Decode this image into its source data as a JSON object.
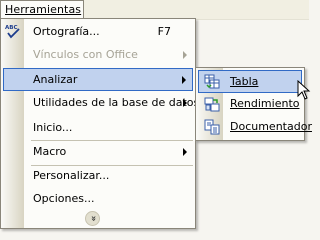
{
  "menubar": {
    "menu_title": "Herramientas"
  },
  "menu": {
    "items": [
      {
        "label": "Ortografía...",
        "shortcut": "F7",
        "icon": "spellcheck-icon",
        "enabled": true
      },
      {
        "label": "Vínculos con Office",
        "enabled": false,
        "submenu": true
      },
      {
        "label": "Analizar",
        "highlighted": true,
        "submenu": true
      },
      {
        "label": "Utilidades de la base de datos",
        "submenu": true
      },
      {
        "label": "Inicio..."
      },
      {
        "label": "Macro",
        "submenu": true
      },
      {
        "label": "Personalizar..."
      },
      {
        "label": "Opciones..."
      }
    ],
    "expand_glyph": "»"
  },
  "submenu": {
    "items": [
      {
        "label": "Tabla",
        "icon": "table-analyzer-icon",
        "highlighted": true
      },
      {
        "label": "Rendimiento",
        "icon": "performance-analyzer-icon"
      },
      {
        "label": "Documentador",
        "icon": "documenter-icon"
      }
    ]
  },
  "colors": {
    "highlight_fill": "#c1d2ee",
    "highlight_border": "#316ac5",
    "disabled_text": "#a6a396"
  }
}
